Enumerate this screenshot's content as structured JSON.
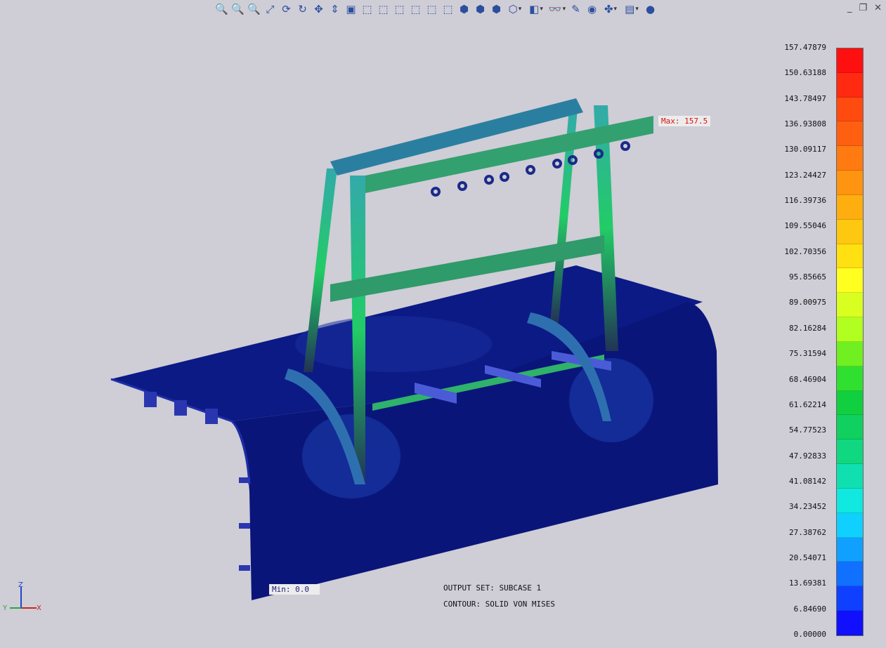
{
  "toolbar": {
    "icons": [
      {
        "name": "zoom-in-icon",
        "glyph": "🔍"
      },
      {
        "name": "zoom-icon",
        "glyph": "🔍"
      },
      {
        "name": "zoom-out-icon",
        "glyph": "🔍"
      },
      {
        "name": "magnify-select-icon",
        "glyph": "⤢"
      },
      {
        "name": "rotate-icon",
        "glyph": "⟳"
      },
      {
        "name": "dynamic-rotate-icon",
        "glyph": "↻"
      },
      {
        "name": "pan-icon",
        "glyph": "✥"
      },
      {
        "name": "pan-vertical-icon",
        "glyph": "⇕"
      },
      {
        "name": "view-front-icon",
        "glyph": "▣"
      },
      {
        "name": "view-cube-1-icon",
        "glyph": "⬚"
      },
      {
        "name": "view-cube-2-icon",
        "glyph": "⬚"
      },
      {
        "name": "view-cube-3-icon",
        "glyph": "⬚"
      },
      {
        "name": "view-cube-4-icon",
        "glyph": "⬚"
      },
      {
        "name": "view-cube-5-icon",
        "glyph": "⬚"
      },
      {
        "name": "view-cube-6-icon",
        "glyph": "⬚"
      },
      {
        "name": "view-iso-1-icon",
        "glyph": "⬢"
      },
      {
        "name": "view-iso-2-icon",
        "glyph": "⬢"
      },
      {
        "name": "view-iso-3-icon",
        "glyph": "⬢"
      },
      {
        "name": "view-options-icon",
        "glyph": "⬡",
        "dropdown": true
      },
      {
        "name": "render-mode-icon",
        "glyph": "◧",
        "dropdown": true
      },
      {
        "name": "visibility-icon",
        "glyph": "👓",
        "dropdown": true
      },
      {
        "name": "edit-icon",
        "glyph": "✎"
      },
      {
        "name": "color-palette-icon",
        "glyph": "◉"
      },
      {
        "name": "entity-select-icon",
        "glyph": "✤",
        "dropdown": true
      },
      {
        "name": "post-options-icon",
        "glyph": "▤",
        "dropdown": true
      },
      {
        "name": "stop-icon",
        "glyph": "●"
      }
    ]
  },
  "window_controls": {
    "minimize": "_",
    "restore": "❐",
    "close": "✕"
  },
  "legend": {
    "values": [
      "157.47879",
      "150.63188",
      "143.78497",
      "136.93808",
      "130.09117",
      "123.24427",
      "116.39736",
      "109.55046",
      "102.70356",
      "95.85665",
      "89.00975",
      "82.16284",
      "75.31594",
      "68.46904",
      "61.62214",
      "54.77523",
      "47.92833",
      "41.08142",
      "34.23452",
      "27.38762",
      "20.54071",
      "13.69381",
      "6.84690",
      "0.00000"
    ],
    "colors": [
      "#ff1010",
      "#ff2a10",
      "#ff4a10",
      "#ff5f10",
      "#ff7a10",
      "#ff9410",
      "#ffae10",
      "#ffc810",
      "#ffe010",
      "#ffff20",
      "#d8ff20",
      "#b0ff20",
      "#70f020",
      "#30e030",
      "#10d040",
      "#10d060",
      "#10d880",
      "#10e0b0",
      "#10e8e0",
      "#10d0ff",
      "#10a0ff",
      "#1070ff",
      "#1040ff",
      "#1010ff"
    ]
  },
  "labels": {
    "max": "Max: 157.5",
    "min": "Min: 0.0"
  },
  "info": {
    "output_set": "OUTPUT SET:  SUBCASE 1",
    "contour": "CONTOUR:  SOLID VON MISES"
  },
  "triad": {
    "x": "X",
    "y": "Y",
    "z": "Z"
  }
}
